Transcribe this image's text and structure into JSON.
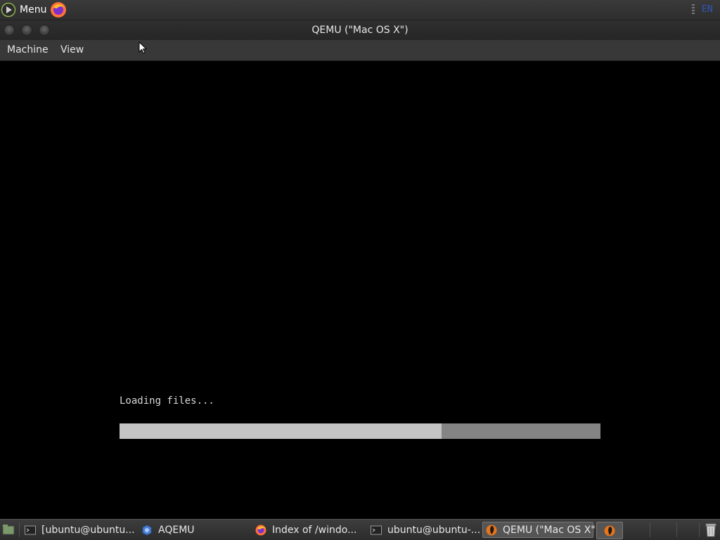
{
  "top_panel": {
    "menu_label": "Menu",
    "menu_icon": "mint-menu-icon",
    "launcher_icon": "firefox-icon",
    "keyboard_layout": "EN"
  },
  "window": {
    "title": "QEMU (\"Mac OS X\")",
    "buttons": [
      "close-button",
      "minimize-button",
      "maximize-button"
    ]
  },
  "menubar": {
    "items": [
      "Machine",
      "View"
    ]
  },
  "vm_screen": {
    "loading_text": "Loading files...",
    "progress": 0.67,
    "progress_fill_color": "#c4c4c4",
    "progress_track_color": "#848484"
  },
  "taskbar": {
    "tasks": [
      {
        "label": "[ubuntu@ubuntu...",
        "icon": "terminal-icon",
        "active": false
      },
      {
        "label": "AQEMU",
        "icon": "aqemu-icon",
        "active": false
      },
      {
        "label": "Index of /windo...",
        "icon": "firefox-icon",
        "active": false
      },
      {
        "label": "ubuntu@ubuntu-...",
        "icon": "terminal-icon",
        "active": false
      },
      {
        "label": "QEMU (\"Mac OS X\")",
        "icon": "qemu-icon",
        "active": true
      }
    ],
    "tray_icons": [
      "qemu-icon",
      "trash-icon"
    ],
    "show_desktop_icon": "show-desktop-icon"
  }
}
